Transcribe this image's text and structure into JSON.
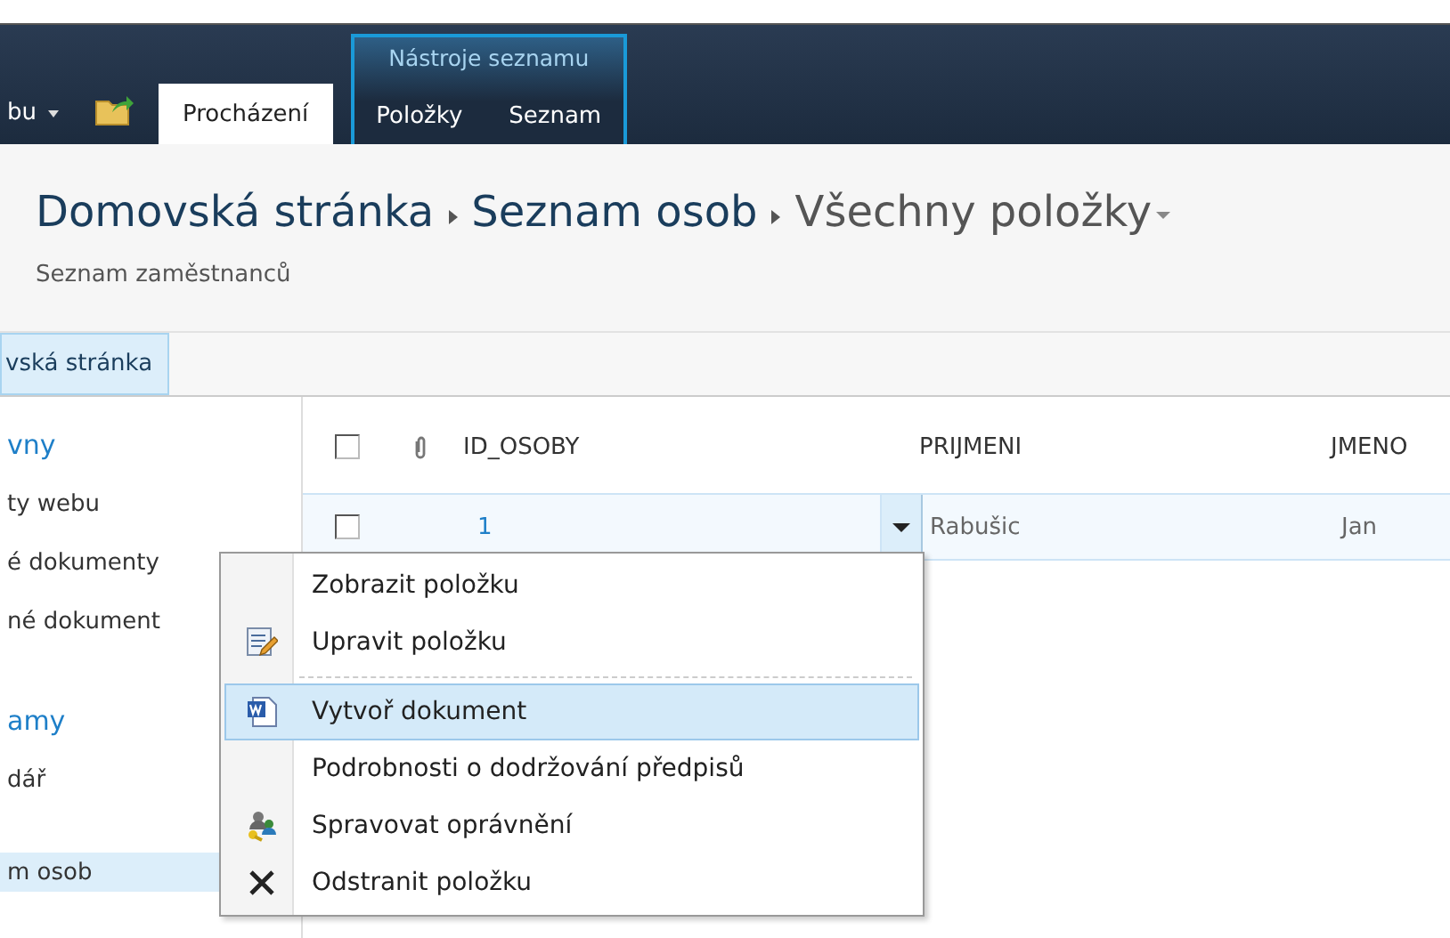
{
  "ribbon": {
    "site_menu": "bu",
    "tabs": [
      {
        "label": "Procházení",
        "selected": true
      }
    ],
    "context_group": {
      "title": "Nástroje seznamu",
      "tabs": [
        {
          "label": "Položky",
          "selected": false
        },
        {
          "label": "Seznam",
          "selected": false
        }
      ]
    }
  },
  "title": {
    "breadcrumb": [
      "Domovská stránka",
      "Seznam osob",
      "Všechny položky"
    ],
    "subtitle": "Seznam zaměstnanců"
  },
  "top_nav": [
    {
      "label": "vská stránka",
      "selected": true
    }
  ],
  "left_nav": [
    {
      "heading": "vny",
      "items": [
        {
          "label": "ty webu",
          "selected": false
        },
        {
          "label": "é dokumenty",
          "selected": false
        },
        {
          "label": "né dokument",
          "selected": false
        }
      ]
    },
    {
      "heading": "amy",
      "items": [
        {
          "label": "dář",
          "selected": false
        },
        {
          "label": "m osob",
          "selected": true
        }
      ]
    }
  ],
  "table": {
    "select_all_checked": false,
    "columns": [
      "ID_OSOBY",
      "PRIJMENI",
      "JMENO"
    ],
    "rows": [
      {
        "checked": false,
        "cells": [
          "1",
          "Rabušic",
          "Jan"
        ]
      }
    ]
  },
  "context_menu": [
    {
      "kind": "view",
      "label": "Zobrazit položku",
      "selected": false
    },
    {
      "kind": "edit",
      "label": "Upravit položku",
      "selected": false
    },
    {
      "kind": "separator"
    },
    {
      "kind": "document",
      "label": "Vytvoř dokument",
      "selected": true
    },
    {
      "kind": "compliance",
      "label": "Podrobnosti o dodržování předpisů",
      "selected": false
    },
    {
      "kind": "permissions",
      "label": "Spravovat oprávnění",
      "selected": false
    },
    {
      "kind": "delete",
      "label": "Odstranit položku",
      "selected": false
    }
  ]
}
